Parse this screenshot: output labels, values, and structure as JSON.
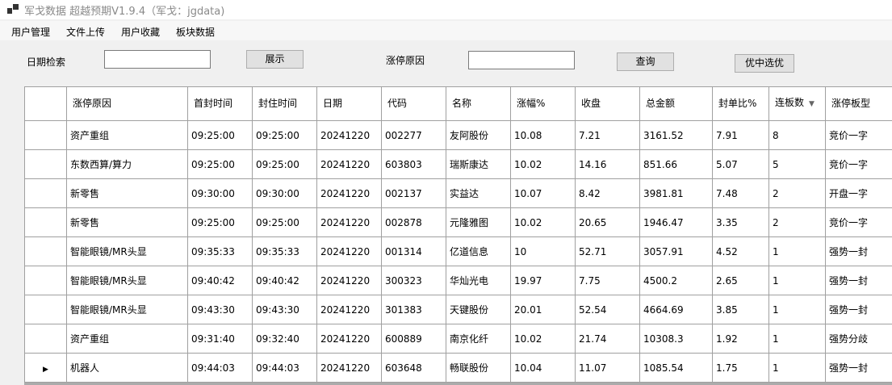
{
  "window": {
    "title": "军戈数据 超越预期V1.9.4（军戈：jgdata)",
    "icon": "app-window-icon"
  },
  "menu": {
    "items": [
      "用户管理",
      "文件上传",
      "用户收藏",
      "板块数据"
    ]
  },
  "search": {
    "date_label": "日期检索",
    "date_value": "",
    "show_button": "展示",
    "reason_label": "涨停原因",
    "reason_value": "",
    "query_button": "查询",
    "select_button": "优中选优"
  },
  "table": {
    "columns": [
      "涨停原因",
      "首封时间",
      "封住时间",
      "日期",
      "代码",
      "名称",
      "涨幅%",
      "收盘",
      "总金额",
      "封单比%",
      "连板数",
      "涨停板型"
    ],
    "sorted_column": "连板数",
    "sort_direction": "descending",
    "current_row": 8,
    "rows": [
      [
        "资产重组",
        "09:25:00",
        "09:25:00",
        "20241220",
        "002277",
        "友阿股份",
        "10.08",
        "7.21",
        "3161.52",
        "7.91",
        "8",
        "竞价一字"
      ],
      [
        "东数西算/算力",
        "09:25:00",
        "09:25:00",
        "20241220",
        "603803",
        "瑞斯康达",
        "10.02",
        "14.16",
        "851.66",
        "5.07",
        "5",
        "竞价一字"
      ],
      [
        "新零售",
        "09:30:00",
        "09:30:00",
        "20241220",
        "002137",
        "实益达",
        "10.07",
        "8.42",
        "3981.81",
        "7.48",
        "2",
        "开盘一字"
      ],
      [
        "新零售",
        "09:25:00",
        "09:25:00",
        "20241220",
        "002878",
        "元隆雅图",
        "10.02",
        "20.65",
        "1946.47",
        "3.35",
        "2",
        "竞价一字"
      ],
      [
        "智能眼镜/MR头显",
        "09:35:33",
        "09:35:33",
        "20241220",
        "001314",
        "亿道信息",
        "10",
        "52.71",
        "3057.91",
        "4.52",
        "1",
        "强势一封"
      ],
      [
        "智能眼镜/MR头显",
        "09:40:42",
        "09:40:42",
        "20241220",
        "300323",
        "华灿光电",
        "19.97",
        "7.75",
        "4500.2",
        "2.65",
        "1",
        "强势一封"
      ],
      [
        "智能眼镜/MR头显",
        "09:43:30",
        "09:43:30",
        "20241220",
        "301383",
        "天键股份",
        "20.01",
        "52.54",
        "4664.69",
        "3.85",
        "1",
        "强势一封"
      ],
      [
        "资产重组",
        "09:31:40",
        "09:32:40",
        "20241220",
        "600889",
        "南京化纤",
        "10.02",
        "21.74",
        "10308.3",
        "1.92",
        "1",
        "强势分歧"
      ],
      [
        "机器人",
        "09:44:03",
        "09:44:03",
        "20241220",
        "603648",
        "畅联股份",
        "10.04",
        "11.07",
        "1085.54",
        "1.75",
        "1",
        "强势一封"
      ]
    ]
  }
}
